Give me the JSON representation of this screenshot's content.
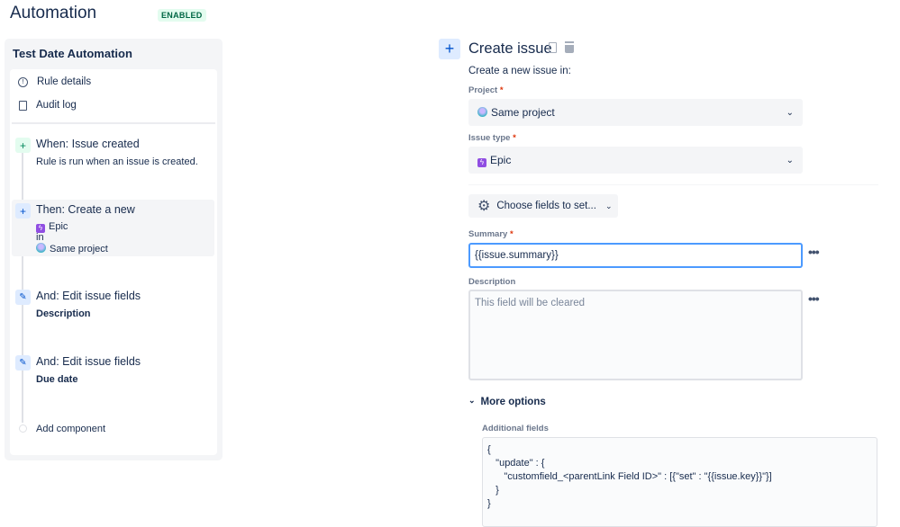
{
  "header": {
    "title": "Automation",
    "status": "ENABLED"
  },
  "sidebar": {
    "rule_name": "Test Date Automation",
    "nav": [
      {
        "label": "Rule details",
        "icon": "info-icon"
      },
      {
        "label": "Audit log",
        "icon": "document-icon"
      }
    ],
    "steps": [
      {
        "title": "When: Issue created",
        "desc": "Rule is run when an issue is created."
      },
      {
        "title": "Then: Create a new",
        "type": "Epic",
        "in": "in",
        "project": "Same project"
      },
      {
        "title": "And: Edit issue fields",
        "field": "Description"
      },
      {
        "title": "And: Edit issue fields",
        "field": "Due date"
      }
    ],
    "add_component": "Add component"
  },
  "main": {
    "title": "Create issue",
    "subtitle": "Create a new issue in:",
    "project_label": "Project",
    "project_value": "Same project",
    "issue_type_label": "Issue type",
    "issue_type_value": "Epic",
    "choose_fields": "Choose fields to set...",
    "summary_label": "Summary",
    "summary_value": "{{issue.summary}}",
    "description_label": "Description",
    "description_placeholder": "This field will be cleared",
    "more_options": "More options",
    "additional_fields_label": "Additional fields",
    "additional_fields_lines": [
      "{",
      "   \"update\" : {",
      "      \"customfield_<parentLink Field ID>\" : [{\"set\" : \"{{issue.key}}\"}]",
      "   }",
      "}"
    ],
    "required_mark": "*"
  },
  "colors": {
    "accent": "#0052cc",
    "enabled_bg": "#e3fcef",
    "epic": "#904ee2"
  }
}
